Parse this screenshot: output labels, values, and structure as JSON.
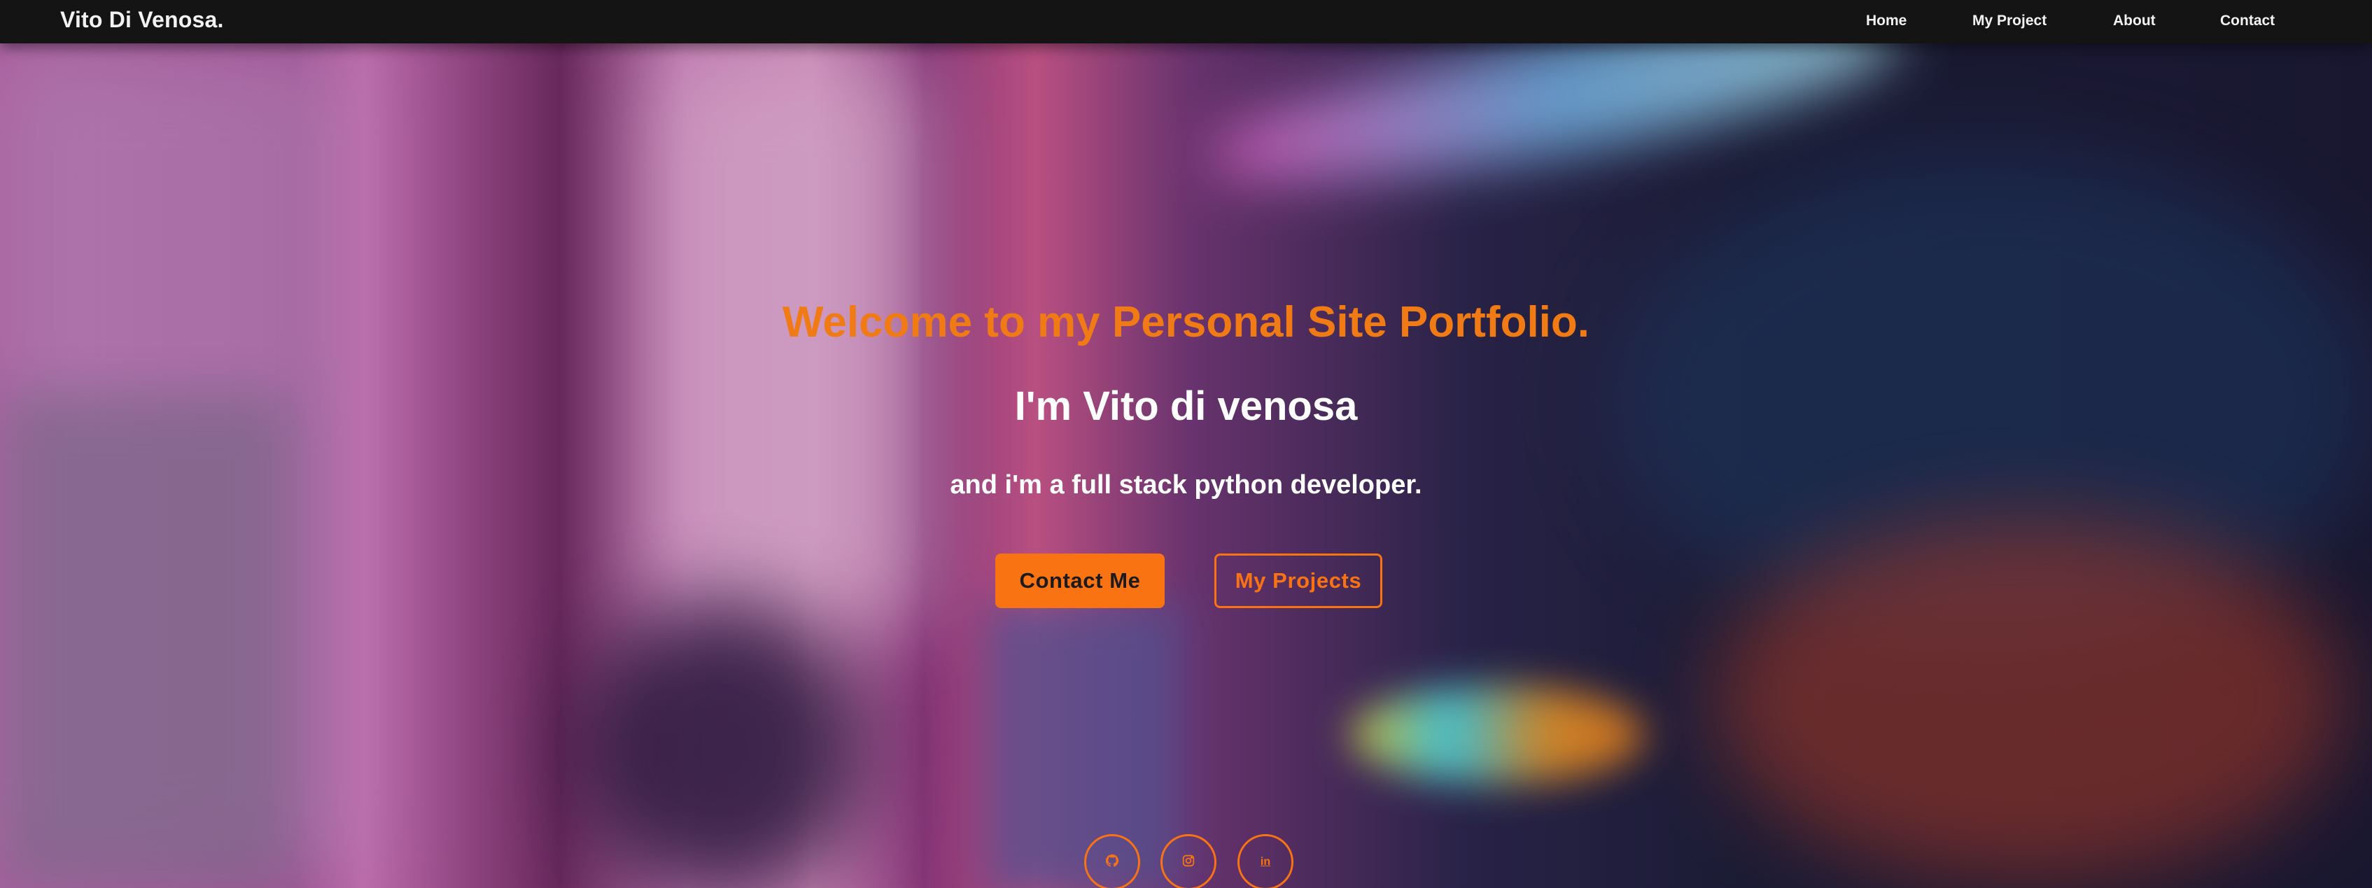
{
  "navbar": {
    "brand": "Vito Di Venosa.",
    "links": [
      "Home",
      "My Project",
      "About",
      "Contact"
    ]
  },
  "hero": {
    "welcome": "Welcome to my Personal Site Portfolio.",
    "name": "I'm Vito di venosa",
    "tagline": "and i'm a full stack python developer.",
    "buttons": {
      "contact": "Contact Me",
      "projects": "My Projects"
    }
  },
  "social": {
    "icons": [
      "github-icon",
      "instagram-icon",
      "linkedin-icon"
    ],
    "linkedin_text": "in"
  },
  "colors": {
    "accent": "#f97313",
    "navbar": "#141414",
    "text": "#ffffff"
  }
}
